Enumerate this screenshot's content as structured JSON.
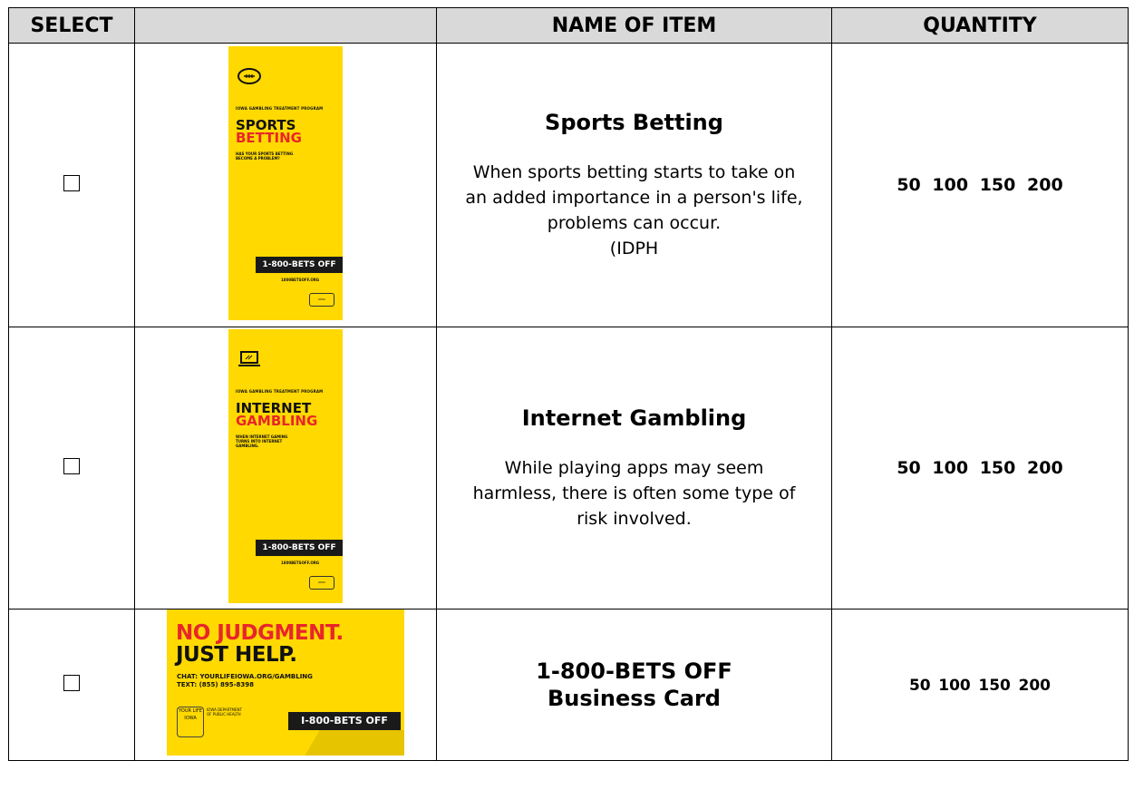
{
  "headers": {
    "select": "SELECT",
    "image": "",
    "name": "NAME OF ITEM",
    "quantity": "QUANTITY"
  },
  "items": [
    {
      "title": "Sports Betting",
      "description": [
        "When sports betting starts to take on",
        "an added importance in a person's life,",
        "problems can occur.",
        "(IDPH"
      ],
      "quantities": [
        "50",
        "100",
        "150",
        "200"
      ],
      "thumbnail": {
        "icon": "football-icon",
        "program": "IOWA GAMBLING TREATMENT PROGRAM",
        "title_line1": "SPORTS",
        "title_line2": "BETTING",
        "subtitle": "HAS YOUR SPORTS BETTING BECOME A PROBLEM?",
        "phone": "1-800-BETS OFF",
        "url": "1800BETSOFF.ORG"
      }
    },
    {
      "title": "Internet Gambling",
      "description": [
        "While playing apps may seem",
        "harmless, there is often some type of",
        "risk involved."
      ],
      "quantities": [
        "50",
        "100",
        "150",
        "200"
      ],
      "thumbnail": {
        "icon": "laptop-icon",
        "program": "IOWA GAMBLING TREATMENT PROGRAM",
        "title_line1": "INTERNET",
        "title_line2": "GAMBLING",
        "subtitle": "WHEN INTERNET GAMING TURNS INTO INTERNET GAMBLING.",
        "phone": "1-800-BETS OFF",
        "url": "1800BETSOFF.ORG"
      }
    },
    {
      "title_line1": "1-800-BETS OFF",
      "title_line2": "Business Card",
      "quantities": [
        "50",
        "100",
        "150",
        "200"
      ],
      "thumbnail": {
        "headline1": "NO JUDGMENT.",
        "headline2": "JUST HELP.",
        "chat": "CHAT: YOURLIFEIOWA.ORG/GAMBLING",
        "text": "TEXT: (855) 895-8398",
        "logo": "YOUR LIFE IOWA",
        "dept": "IOWA DEPARTMENT OF PUBLIC HEALTH",
        "phone": "I-800-BETS OFF"
      }
    }
  ],
  "colors": {
    "header_bg": "#d9d9d9",
    "brochure_yellow": "#ffd900",
    "brand_red": "#e8262a"
  }
}
